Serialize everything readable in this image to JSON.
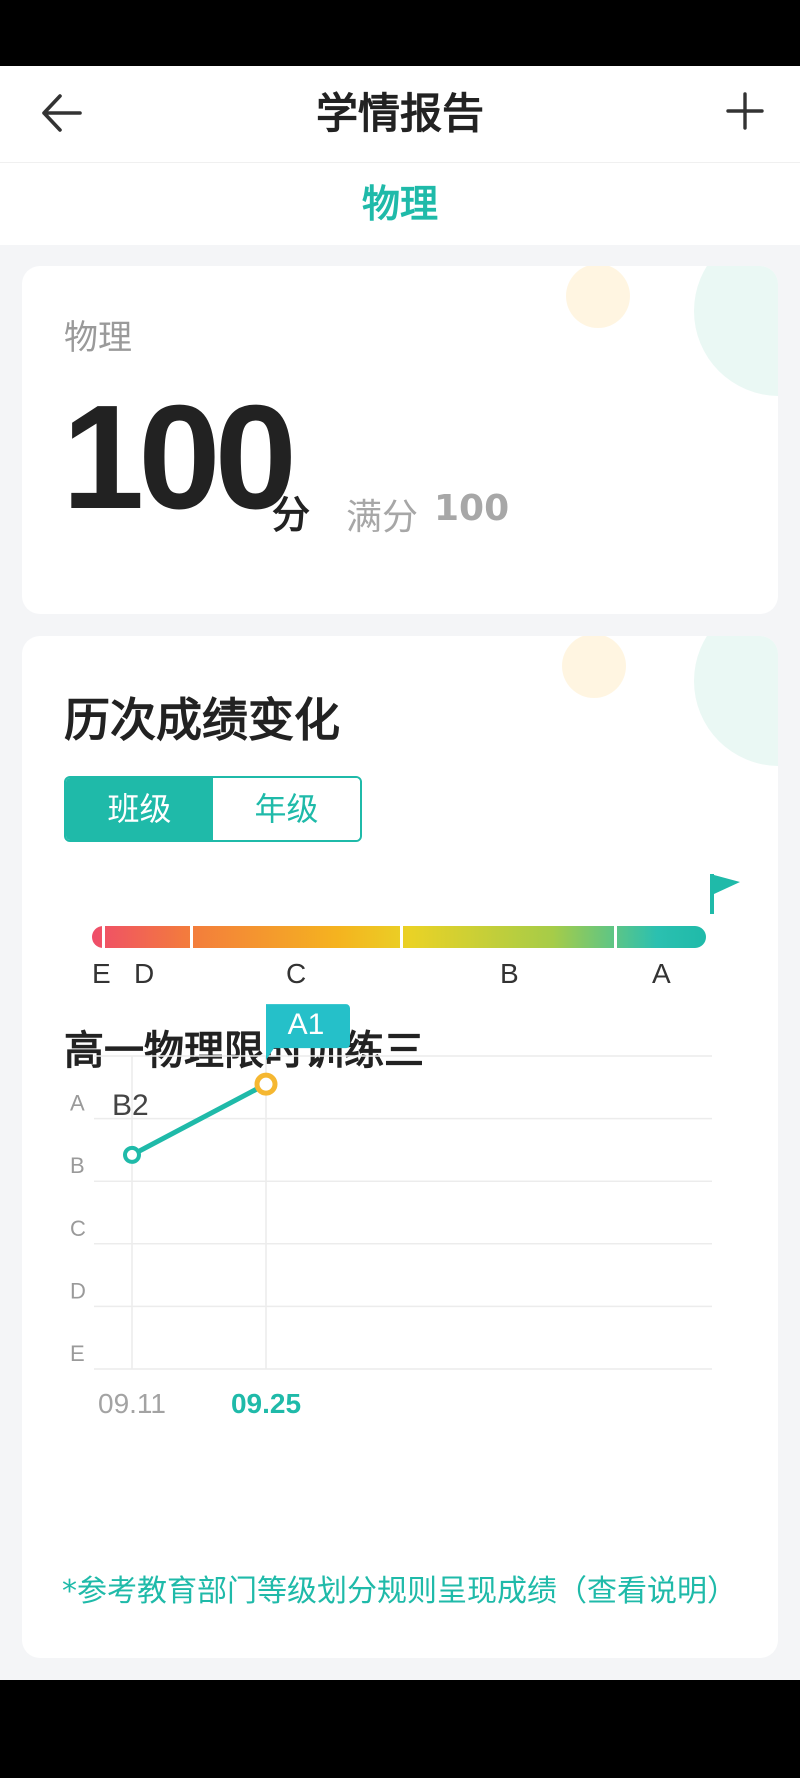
{
  "header": {
    "title": "学情报告",
    "back_icon": "arrow-left-icon",
    "add_icon": "plus-icon"
  },
  "subject_tab": "物理",
  "score_card": {
    "subject": "物理",
    "score": "100",
    "unit": "分",
    "full_label": "满分",
    "full_value": "100"
  },
  "history": {
    "title": "历次成绩变化",
    "segments": [
      {
        "label": "班级",
        "active": true
      },
      {
        "label": "年级",
        "active": false
      }
    ],
    "grade_scale": [
      "E",
      "D",
      "C",
      "B",
      "A"
    ],
    "exam_title": "高一物理限时训练三",
    "note": "*参考教育部门等级划分规则呈现成绩（查看说明）"
  },
  "colors": {
    "accent": "#1fbaa9",
    "marker": "#f5b731",
    "callout": "#25c0c9"
  },
  "chart_data": {
    "type": "line",
    "x": [
      "09.11",
      "09.25"
    ],
    "y_categories": [
      "A",
      "B",
      "C",
      "D",
      "E"
    ],
    "series": [
      {
        "values": [
          "B2",
          "A1"
        ]
      }
    ],
    "highlighted": "09.25",
    "callout_label": "A1",
    "point_label": "B2",
    "grid": true
  }
}
